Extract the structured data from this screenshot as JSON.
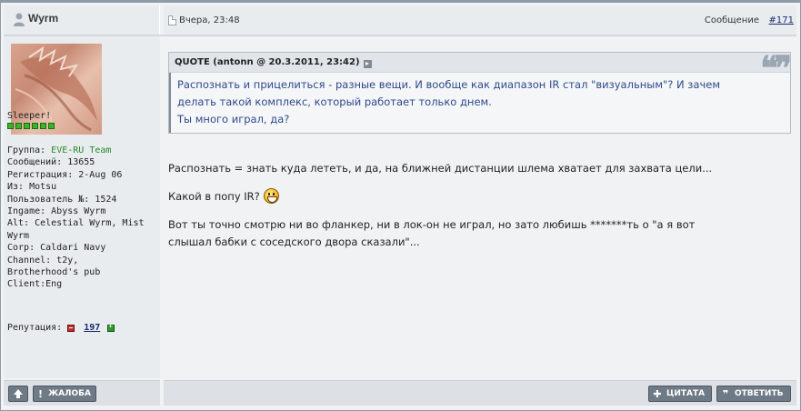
{
  "author": {
    "name": "Wyrm"
  },
  "post": {
    "date": "Вчера, 23:48",
    "number_label": "Сообщение",
    "number": "#171"
  },
  "profile": {
    "rank_title": "Sleeper!",
    "pips": 6,
    "group_label": "Группа: ",
    "group_value": "EVE-RU Team",
    "messages": "Сообщений: 13655",
    "registered": "Регистрация: 2-Aug 06",
    "from": "Из: Motsu",
    "user_no": "Пользователь №: 1524",
    "ingame": "Ingame: Abyss Wyrm",
    "alt": "Alt: Celestial Wyrm, Mist Wyrm",
    "corp": "Corp: Caldari Navy",
    "channel": "Channel: t2y, Brotherhood's pub",
    "client": "Client:Eng",
    "reputation_label": "Репутация:",
    "reputation_value": "197"
  },
  "quote": {
    "header": "QUOTE (antonn @ 20.3.2011, 23:42)",
    "lines": [
      "Распознать и прицелиться - разные вещи. И вообще как диапазон IR стал \"визуальным\"? И зачем",
      "делать такой комплекс, который работает только днем.",
      "Ты много играл, да?"
    ]
  },
  "message": {
    "p1": "Распознать = знать куда лететь, и да, на ближней дистанции шлема хватает для захвата цели...",
    "p2": "Какой в попу IR?",
    "p3a": "Вот ты точно смотрю ни во фланкер, ни в лок-он не играл, но зато любишь *******ть о \"а я вот",
    "p3b": "слышал бабки с соседского двора сказали\"..."
  },
  "buttons": {
    "report": "ЖАЛОБА",
    "quote": "ЦИТАТА",
    "reply": "ОТВЕТИТЬ"
  },
  "colors": {
    "link": "#1a2a6c",
    "quote_text": "#2f4a8a",
    "group": "#2a8a2a",
    "button": "#6e7a86"
  }
}
